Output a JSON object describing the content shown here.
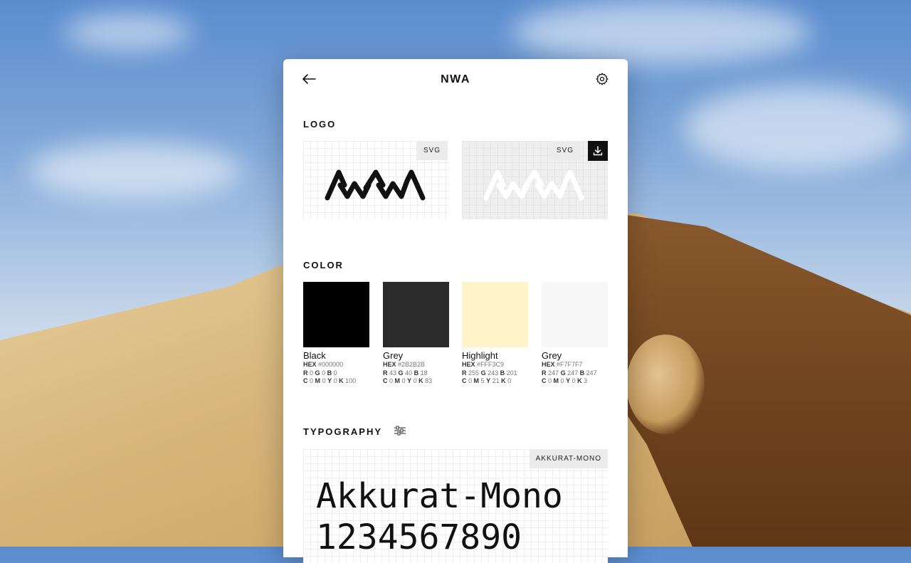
{
  "header": {
    "title": "NWA"
  },
  "logo": {
    "section_label": "LOGO",
    "tiles": [
      {
        "badge": "SVG",
        "variant": "dark-on-light"
      },
      {
        "badge": "SVG",
        "variant": "light-on-grey"
      }
    ]
  },
  "color": {
    "section_label": "COLOR",
    "swatches": [
      {
        "name": "Black",
        "swatch": "#000000",
        "hex_label": "HEX",
        "hex": "#000000",
        "r": "0",
        "g": "0",
        "b": "0",
        "c": "0",
        "m": "0",
        "y": "0",
        "k": "100"
      },
      {
        "name": "Grey",
        "swatch": "#2B2B2B",
        "hex_label": "HEX",
        "hex": "#2B2B2B",
        "r": "43",
        "g": "40",
        "b": "18",
        "c": "0",
        "m": "0",
        "y": "0",
        "k": "83"
      },
      {
        "name": "Highlight",
        "swatch": "#FFF3C9",
        "hex_label": "HEX",
        "hex": "#FFF3C9",
        "r": "255",
        "g": "243",
        "b": "201",
        "c": "0",
        "m": "5",
        "y": "21",
        "k": "0"
      },
      {
        "name": "Grey",
        "swatch": "#F7F7F7",
        "hex_label": "HEX",
        "hex": "#F7F7F7",
        "r": "247",
        "g": "247",
        "b": "247",
        "c": "0",
        "m": "0",
        "y": "0",
        "k": "3"
      }
    ]
  },
  "typography": {
    "section_label": "TYPOGRAPHY",
    "font_badge": "AKKURAT-MONO",
    "sample_name": "Akkurat-Mono",
    "sample_digits": "1234567890"
  },
  "icons": {
    "back": "arrow-left-icon",
    "settings": "gear-icon",
    "download": "download-icon",
    "typography_settings": "sliders-icon"
  }
}
